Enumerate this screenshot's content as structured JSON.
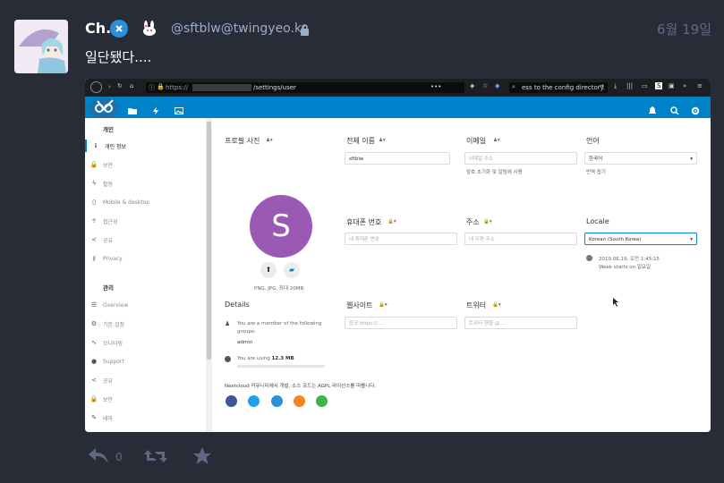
{
  "post": {
    "display_name": "Ch.",
    "account": "@sftblw@twingyeo.kr",
    "time": "6월 19일",
    "content": "일단됐다....",
    "reply_count": "0"
  },
  "browser": {
    "url_prefix": "https://",
    "url_path": "/settings/user",
    "search_text": "ess to the config directory."
  },
  "sidebar": {
    "personal_heading": "개인",
    "admin_heading": "관리",
    "personal_items": [
      {
        "label": "개인 정보",
        "icon": "info-icon"
      },
      {
        "label": "보안",
        "icon": "lock-icon"
      },
      {
        "label": "활동",
        "icon": "bolt-icon"
      },
      {
        "label": "Mobile & desktop",
        "icon": "phone-icon"
      },
      {
        "label": "접근성",
        "icon": "accessibility-icon"
      },
      {
        "label": "공유",
        "icon": "share-icon"
      },
      {
        "label": "Privacy",
        "icon": "key-icon"
      }
    ],
    "admin_items": [
      {
        "label": "Overview",
        "icon": "list-icon"
      },
      {
        "label": "기본 설정",
        "icon": "gear-icon"
      },
      {
        "label": "모니터링",
        "icon": "pulse-icon"
      },
      {
        "label": "Support",
        "icon": "chat-icon"
      },
      {
        "label": "공유",
        "icon": "share-icon"
      },
      {
        "label": "보안",
        "icon": "lock-icon"
      },
      {
        "label": "테마",
        "icon": "brush-icon"
      }
    ]
  },
  "settings": {
    "profile_photo_label": "프로필 사진",
    "avatar_letter": "S",
    "avatar_hint": "PNG, JPG, 최대 20MB",
    "fullname_label": "전체 이름",
    "fullname_value": "sftblw",
    "email_label": "이메일",
    "email_placeholder": "이메일 주소",
    "email_hint": "암호 초기화 및 알림에 사용",
    "language_label": "언어",
    "language_value": "한국어",
    "language_hint": "번역 돕기",
    "phone_label": "휴대폰 번호",
    "phone_placeholder": "내 휴대폰 번호",
    "address_label": "주소",
    "address_placeholder": "내 우편 주소",
    "locale_label": "Locale",
    "locale_value": "Korean (South Korea)",
    "locale_date": "2019.06.19. 오전 1:45:15",
    "locale_week": "Week starts on 일요일",
    "details_label": "Details",
    "details_groups": "You are a member of the following groups:",
    "details_group_name": "admin",
    "details_usage_prefix": "You are using ",
    "details_usage_value": "12.3 MB",
    "website_label": "웹사이트",
    "website_placeholder": "링크 https://...",
    "twitter_label": "트위터",
    "twitter_placeholder": "트위터 핸들 @...",
    "footer_text": "Nextcloud 커뮤니티에서 개발, 소스 코드는 AGPL 라이선스를 따릅니다."
  },
  "colors": {
    "nextcloud_blue": "#0082c9",
    "avatar_purple": "#9b59b6",
    "mastodon_bg": "#282c37",
    "muted": "#606984"
  }
}
